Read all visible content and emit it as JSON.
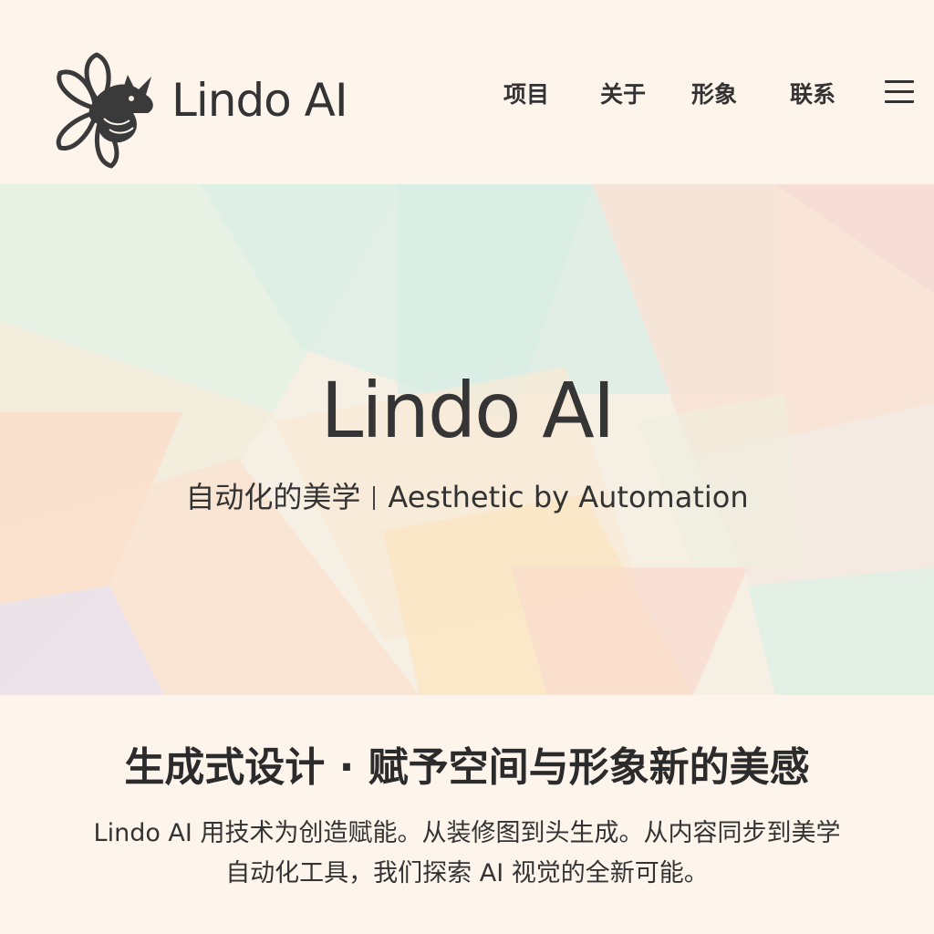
{
  "header": {
    "brand": "Lindo AI",
    "logo_icon": "dragon-flower-logo-icon",
    "nav": [
      {
        "label": "项目"
      },
      {
        "label": "关于"
      },
      {
        "label": "形象"
      },
      {
        "label": "联系"
      }
    ],
    "menu_icon": "hamburger-menu-icon"
  },
  "hero": {
    "title": "Lindo AI",
    "subtitle_cn": "自动化的美学",
    "subtitle_en": "Aesthetic by Automation"
  },
  "section": {
    "title": "生成式设计 · 赋予空间与形象新的美感",
    "body_line1": "Lindo AI 用技术为创造赋能。从装修图到头生成。从内容同步到美学",
    "body_line2": "自动化工具，我们探索 AI 视觉的全新可能。"
  },
  "colors": {
    "background": "#fdf5ec",
    "text": "#333333",
    "pastel_mint": "#d7f0e4",
    "pastel_peach": "#fbd9c4",
    "pastel_yellow": "#fbe8c0",
    "pastel_lavender": "#e6e2f3"
  }
}
